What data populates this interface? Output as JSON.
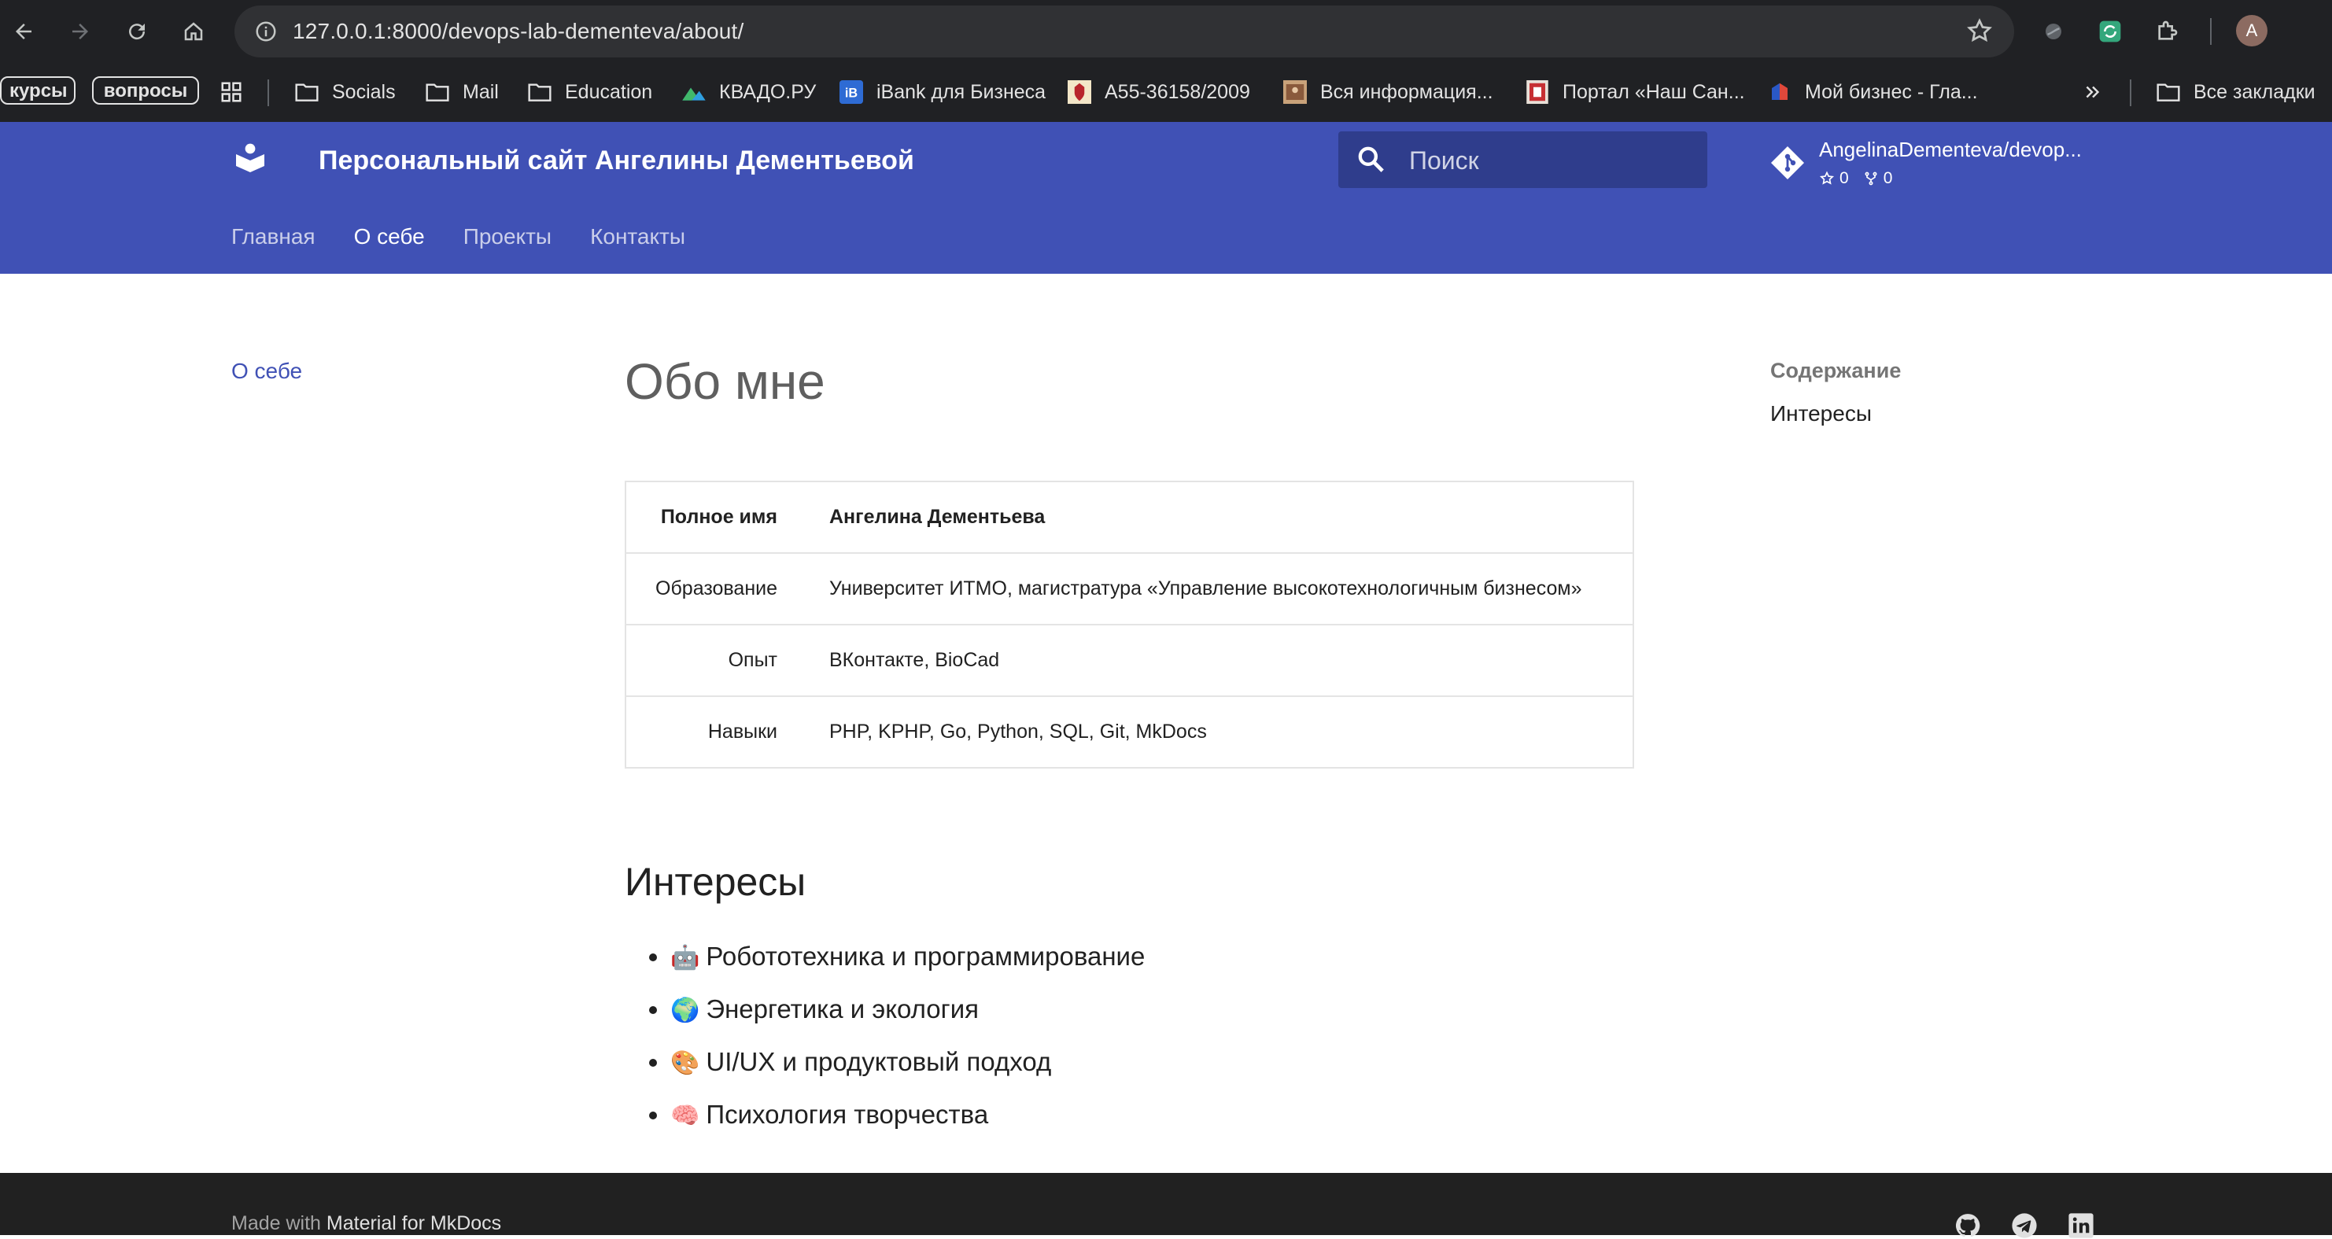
{
  "browser": {
    "url_host": "127.0.0.1",
    "url_path": ":8000/devops-lab-dementeva/about/",
    "profile_initial": "A",
    "bookmarks": [
      {
        "label": "курсы",
        "icon": "pill"
      },
      {
        "label": "вопросы",
        "icon": "pill"
      },
      {
        "label": "Socials",
        "icon": "folder-icon"
      },
      {
        "label": "Mail",
        "icon": "folder-icon"
      },
      {
        "label": "Education",
        "icon": "folder-icon"
      },
      {
        "label": "КВАДО.РУ",
        "icon": "kvado-icon"
      },
      {
        "label": "iBank для Бизнеса",
        "icon": "ibank-icon"
      },
      {
        "label": "А55-36158/2009",
        "icon": "emblem-icon"
      },
      {
        "label": "Вся информация...",
        "icon": "picture-icon"
      },
      {
        "label": "Портал «Наш Сан...",
        "icon": "portal-icon"
      },
      {
        "label": "Мой бизнес - Гла...",
        "icon": "business-icon"
      },
      {
        "label": "Все закладки",
        "icon": "folder-icon"
      }
    ]
  },
  "header": {
    "site_title": "Персональный сайт Ангелины Дементьевой",
    "search_placeholder": "Поиск",
    "repo_name": "AngelinaDementeva/devop...",
    "stars": "0",
    "forks": "0",
    "tabs": [
      "Главная",
      "О себе",
      "Проекты",
      "Контакты"
    ],
    "active_tab": "О себе"
  },
  "sidebar": {
    "link": "О себе"
  },
  "toc": {
    "title": "Содержание",
    "items": [
      "Интересы"
    ]
  },
  "main": {
    "title": "Обо мне",
    "table": {
      "header": {
        "label": "Полное имя",
        "value": "Ангелина Дементьева"
      },
      "rows": [
        {
          "label": "Образование",
          "value": "Университет ИТМО, магистратура «Управление высокотехнологичным бизнесом»"
        },
        {
          "label": "Опыт",
          "value": "ВКонтакте, BioCad"
        },
        {
          "label": "Навыки",
          "value": "PHP, KPHP, Go, Python, SQL, Git, MkDocs"
        }
      ]
    },
    "interests_title": "Интересы",
    "interests": [
      {
        "emoji": "🤖",
        "text": "Робототехника и программирование"
      },
      {
        "emoji": "🌍",
        "text": "Энергетика и экология"
      },
      {
        "emoji": "🎨",
        "text": "UI/UX и продуктовый подход"
      },
      {
        "emoji": "🧠",
        "text": "Психология творчества"
      }
    ]
  },
  "footer": {
    "made_with": "Made with",
    "made_link": "Material for MkDocs",
    "socials": [
      "github-icon",
      "telegram-icon",
      "linkedin-icon"
    ]
  },
  "colors": {
    "primary": "#4051b5",
    "footer_bg": "#212121",
    "browser_chrome": "#202124"
  }
}
